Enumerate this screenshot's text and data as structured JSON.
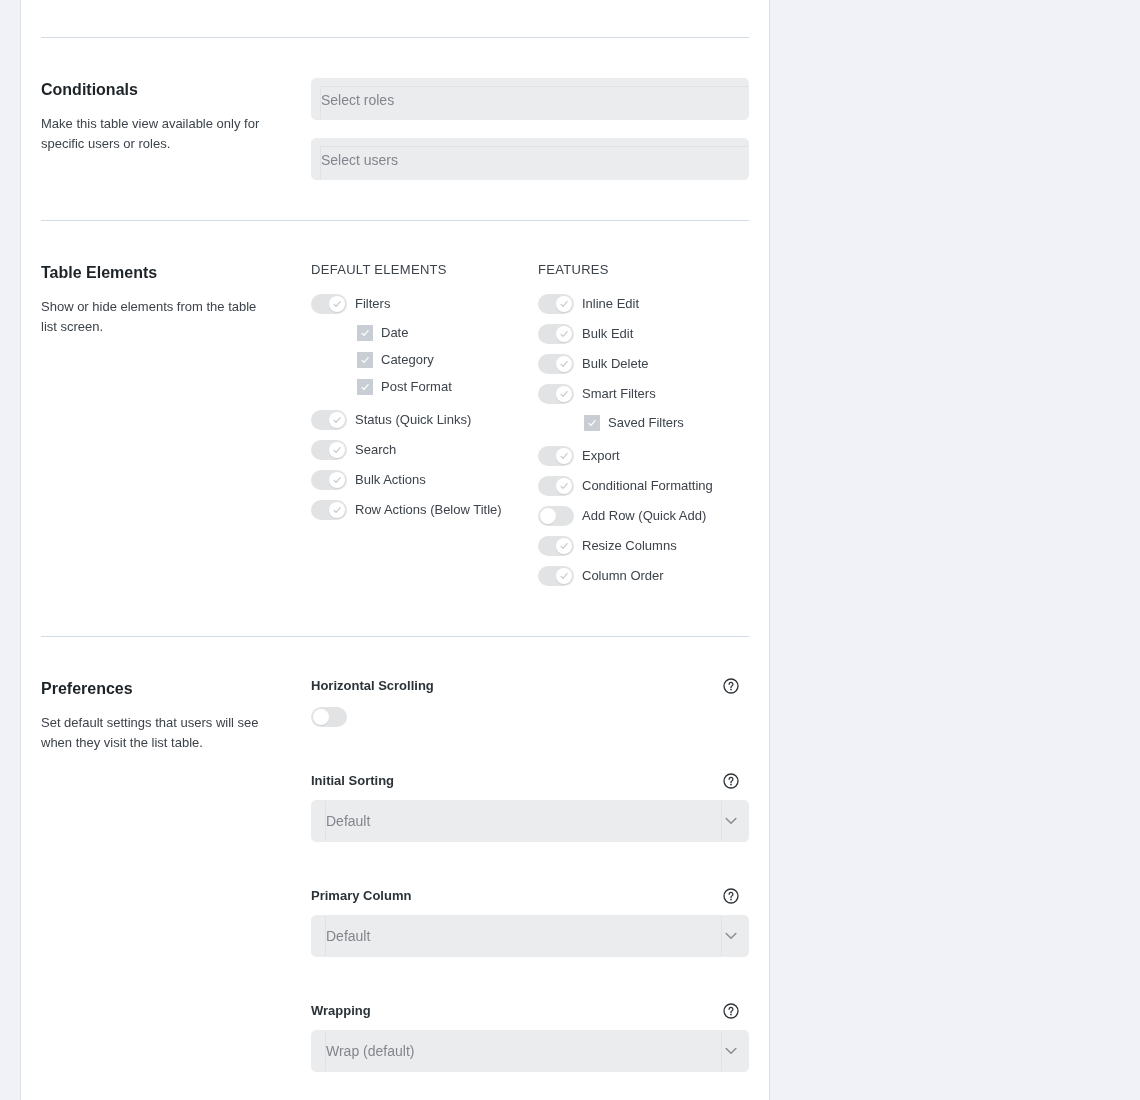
{
  "disabled": true,
  "sections": [
    {
      "kind": "fields",
      "title": "Conditionals",
      "description": "Make this table view available only for specific users or roles.",
      "fields": [
        {
          "placeholder": "Select roles"
        },
        {
          "placeholder": "Select users"
        }
      ]
    },
    {
      "kind": "elements",
      "title": "Table Elements",
      "description": "Show or hide elements from the table list screen.",
      "groups": [
        {
          "heading": "DEFAULT ELEMENTS",
          "items": [
            {
              "label": "Filters",
              "on": true,
              "children": [
                {
                  "label": "Date",
                  "checked": true
                },
                {
                  "label": "Category",
                  "checked": true
                },
                {
                  "label": "Post Format",
                  "checked": true
                }
              ]
            },
            {
              "label": "Status (Quick Links)",
              "on": true
            },
            {
              "label": "Search",
              "on": true
            },
            {
              "label": "Bulk Actions",
              "on": true
            },
            {
              "label": "Row Actions (Below Title)",
              "on": true
            }
          ]
        },
        {
          "heading": "FEATURES",
          "items": [
            {
              "label": "Inline Edit",
              "on": true
            },
            {
              "label": "Bulk Edit",
              "on": true
            },
            {
              "label": "Bulk Delete",
              "on": true
            },
            {
              "label": "Smart Filters",
              "on": true,
              "children": [
                {
                  "label": "Saved Filters",
                  "checked": true
                }
              ]
            },
            {
              "label": "Export",
              "on": true
            },
            {
              "label": "Conditional Formatting",
              "on": true
            },
            {
              "label": "Add Row (Quick Add)",
              "on": false
            },
            {
              "label": "Resize Columns",
              "on": true
            },
            {
              "label": "Column Order",
              "on": true
            }
          ]
        }
      ]
    },
    {
      "kind": "preferences",
      "title": "Preferences",
      "description": "Set default settings that users will see when they visit the list table.",
      "settings": [
        {
          "kind": "toggle",
          "label": "Horizontal Scrolling",
          "on": false
        },
        {
          "kind": "select",
          "label": "Initial Sorting",
          "value": "Default"
        },
        {
          "kind": "select",
          "label": "Primary Column",
          "value": "Default"
        },
        {
          "kind": "select",
          "label": "Wrapping",
          "value": "Wrap (default)"
        }
      ]
    }
  ]
}
